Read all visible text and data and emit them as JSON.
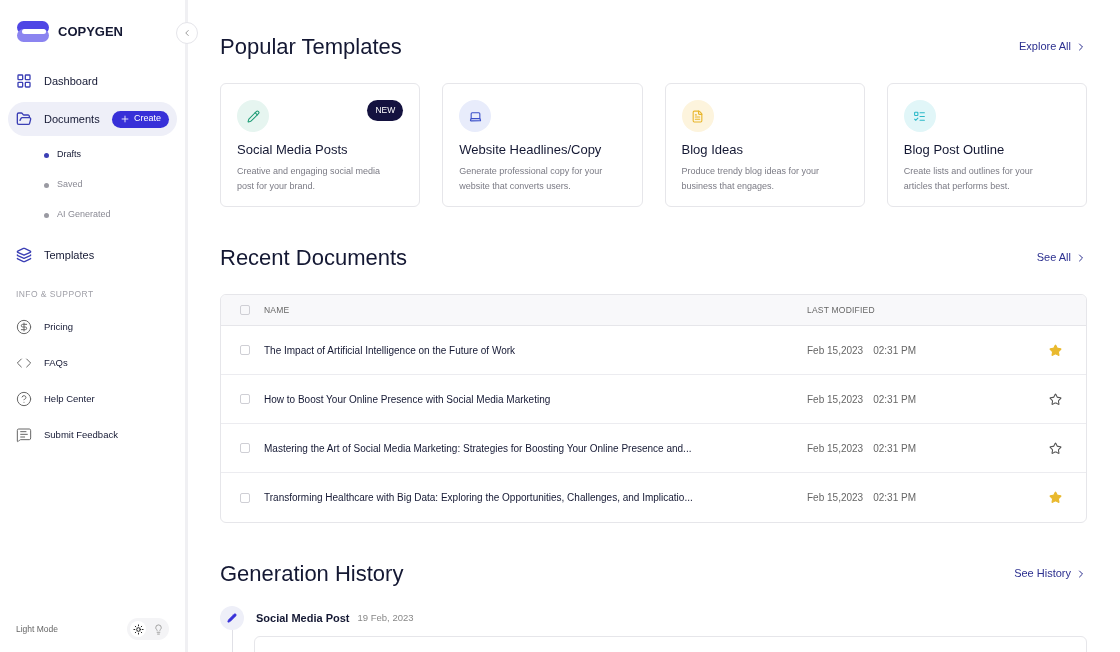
{
  "sidebar": {
    "brand": "COPYGEN",
    "nav": [
      {
        "kind": "grid",
        "label": "Dashboard",
        "selected": false
      },
      {
        "kind": "folder",
        "label": "Documents",
        "selected": true,
        "action": "Create",
        "children": [
          {
            "label": "Drafts",
            "selected": true
          },
          {
            "label": "Saved",
            "selected": false
          },
          {
            "label": "AI Generated",
            "selected": false
          }
        ]
      },
      {
        "kind": "layers",
        "label": "Templates",
        "selected": false
      }
    ],
    "section_title": "INFO & SUPPORT",
    "support": [
      {
        "kind": "dollar",
        "label": "Pricing"
      },
      {
        "kind": "code",
        "label": "FAQs"
      },
      {
        "kind": "help",
        "label": "Help Center"
      },
      {
        "kind": "chat",
        "label": "Submit Feedback"
      }
    ],
    "theme_label": "Light Mode",
    "theme_toggle": [
      {
        "kind": "sun",
        "selected": true
      },
      {
        "kind": "bulb",
        "selected": false
      }
    ]
  },
  "templates": {
    "title": "Popular Templates",
    "link": "Explore All",
    "cards": [
      {
        "kind": "pencil",
        "title": "Social Media Posts",
        "description": "Creative and engaging social media post for your brand.",
        "badge": "NEW"
      },
      {
        "kind": "laptop",
        "title": "Website Headlines/Copy",
        "description": "Generate professional copy for your website that converts users."
      },
      {
        "kind": "file",
        "title": "Blog Ideas",
        "description": "Produce trendy blog ideas for your business that engages."
      },
      {
        "kind": "list",
        "title": "Blog Post Outline",
        "description": "Create lists and outlines for your articles that performs best."
      }
    ]
  },
  "recent": {
    "title": "Recent Documents",
    "link": "See All",
    "columns": [
      "NAME",
      "LAST MODIFIED"
    ],
    "select_all_checked": false,
    "rows": [
      {
        "name": "The Impact of Artificial Intelligence on the Future of Work",
        "date": "Feb 15,2023",
        "time": "02:31 PM",
        "checked": false,
        "starred": true
      },
      {
        "name": "How to Boost Your Online Presence with Social Media Marketing",
        "date": "Feb 15,2023",
        "time": "02:31 PM",
        "checked": false,
        "starred": false
      },
      {
        "name": "Mastering the Art of Social Media Marketing: Strategies for Boosting Your Online Presence and...",
        "date": "Feb 15,2023",
        "time": "02:31 PM",
        "checked": false,
        "starred": false
      },
      {
        "name": "Transforming Healthcare with Big Data: Exploring the Opportunities, Challenges, and Implicatio...",
        "date": "Feb 15,2023",
        "time": "02:31 PM",
        "checked": false,
        "starred": true
      }
    ]
  },
  "history": {
    "title": "Generation History",
    "link": "See History",
    "entries": [
      {
        "title": "Social Media Post",
        "date": "19 Feb, 2023"
      }
    ]
  }
}
